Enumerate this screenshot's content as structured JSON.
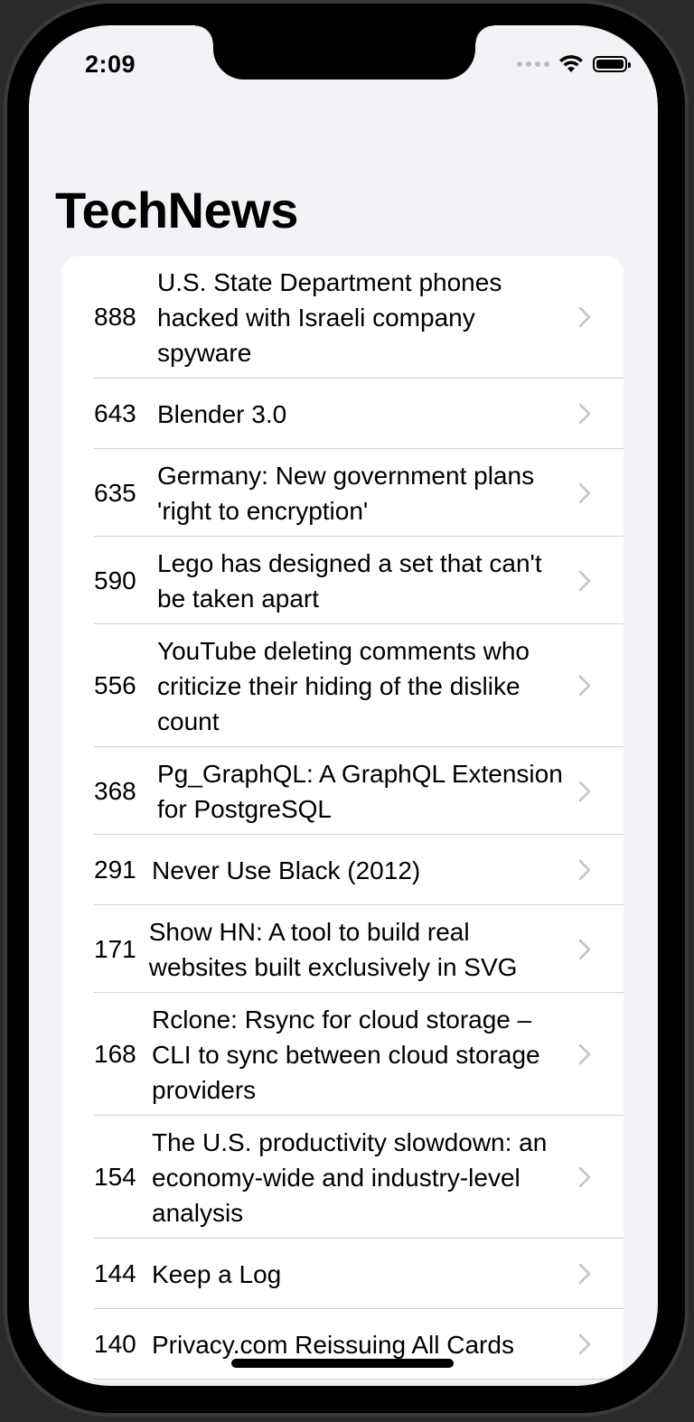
{
  "status_bar": {
    "time": "2:09"
  },
  "nav": {
    "title": "TechNews"
  },
  "stories": [
    {
      "score": "888",
      "title": "U.S. State Department phones hacked with Israeli company spyware"
    },
    {
      "score": "643",
      "title": "Blender 3.0"
    },
    {
      "score": "635",
      "title": "Germany: New government plans 'right to encryption'"
    },
    {
      "score": "590",
      "title": "Lego has designed a set that can't be taken apart"
    },
    {
      "score": "556",
      "title": "YouTube deleting comments who criticize their hiding of the dislike count"
    },
    {
      "score": "368",
      "title": "Pg_GraphQL: A GraphQL Extension for PostgreSQL"
    },
    {
      "score": "291",
      "title": "Never Use Black (2012)"
    },
    {
      "score": "171",
      "title": "Show HN: A tool to build real websites built exclusively in SVG"
    },
    {
      "score": "168",
      "title": "Rclone: Rsync for cloud storage – CLI to sync between cloud storage providers"
    },
    {
      "score": "154",
      "title": "The U.S. productivity slowdown: an economy-wide and industry-level analysis"
    },
    {
      "score": "144",
      "title": "Keep a Log"
    },
    {
      "score": "140",
      "title": "Privacy.com Reissuing All Cards"
    }
  ],
  "icons": {
    "row_accessory": "chevron-right-icon",
    "wifi": "wifi-icon",
    "battery": "battery-icon",
    "signal": "signal-icon"
  },
  "colors": {
    "background": "#f2f2f7",
    "separator": "#d1d1d6",
    "chevron": "#c4c4c7"
  }
}
